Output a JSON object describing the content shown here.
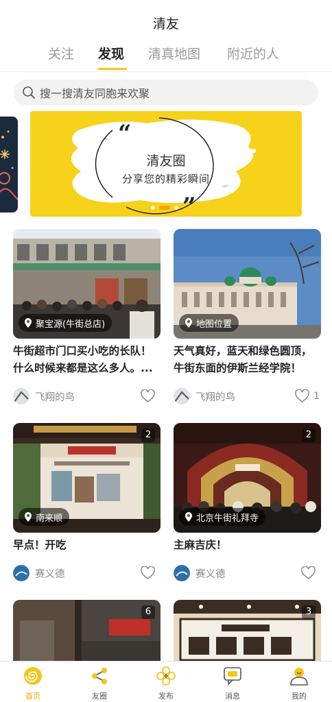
{
  "header": {
    "title": "清友"
  },
  "tabs": [
    {
      "label": "关注",
      "active": false
    },
    {
      "label": "发现",
      "active": true
    },
    {
      "label": "清真地图",
      "active": false
    },
    {
      "label": "附近的人",
      "active": false
    }
  ],
  "search": {
    "placeholder": "搜一搜清友同胞来欢聚"
  },
  "banner": {
    "title": "清友圈",
    "subtitle": "分享您的精彩瞬间",
    "slide_count": 3,
    "active_slide": 2
  },
  "feed": [
    {
      "location": "聚宝源(牛街总店)",
      "title": "牛街超市门口买小吃的长队！什么时候来都是这么多人。...",
      "author": "飞翔的鸟",
      "likes": ""
    },
    {
      "location": "地图位置",
      "title": "天气真好，蓝天和绿色圆顶，牛街东面的伊斯兰经学院！",
      "author": "飞翔的鸟",
      "likes": "1"
    },
    {
      "photo_count": "2",
      "location": "南来顺",
      "title": "早点！开吃",
      "author": "赛义德",
      "likes": ""
    },
    {
      "photo_count": "2",
      "location": "北京牛街礼拜寺",
      "title": "主麻吉庆！",
      "author": "赛义德",
      "likes": ""
    },
    {
      "photo_count": "6"
    },
    {
      "photo_count": "3"
    }
  ],
  "bottom_nav": [
    {
      "label": "首页",
      "icon": "home-swirl-icon",
      "active": true
    },
    {
      "label": "友圈",
      "icon": "share-circle-icon",
      "active": false
    },
    {
      "label": "发布",
      "icon": "publish-flower-icon",
      "active": false
    },
    {
      "label": "消息",
      "icon": "message-icon",
      "active": false
    },
    {
      "label": "我的",
      "icon": "profile-icon",
      "active": false
    }
  ],
  "colors": {
    "accent": "#f5c518",
    "accent_dark": "#f5a300",
    "banner_bg": "#f6d21a",
    "text_primary": "#222222",
    "text_muted": "#888888"
  }
}
